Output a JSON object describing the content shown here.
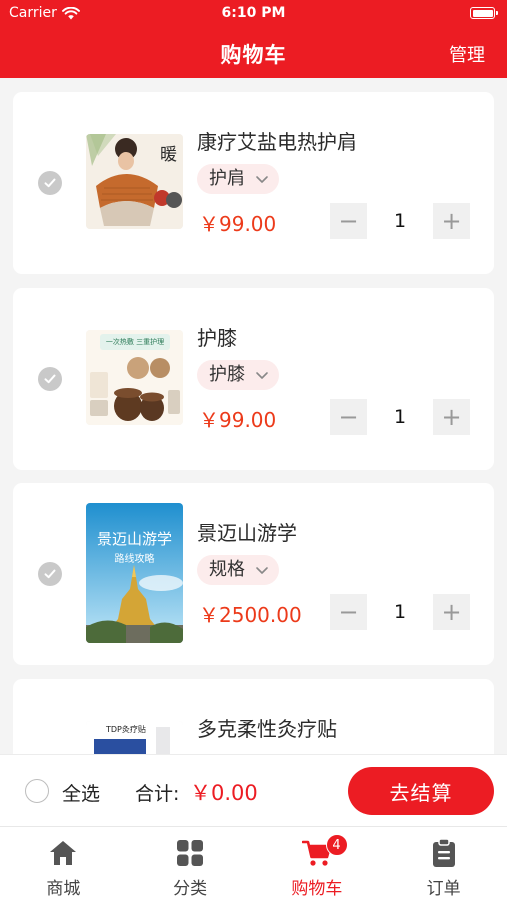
{
  "status_bar": {
    "carrier": "Carrier",
    "time": "6:10 PM"
  },
  "header": {
    "title": "购物车",
    "manage_label": "管理"
  },
  "cart": {
    "items": [
      {
        "name": "康疗艾盐电热护肩",
        "spec": "护肩",
        "price": "￥99.00",
        "quantity": "1",
        "minus": "−",
        "plus": "+"
      },
      {
        "name": "护膝",
        "spec": "护膝",
        "price": "￥99.00",
        "quantity": "1",
        "minus": "−",
        "plus": "+"
      },
      {
        "name": "景迈山游学",
        "spec": "规格",
        "price": "￥2500.00",
        "quantity": "1",
        "minus": "−",
        "plus": "+"
      },
      {
        "name": "多克柔性灸疗贴",
        "spec": "",
        "price": "",
        "quantity": "",
        "minus": "",
        "plus": ""
      }
    ],
    "image_text": {
      "item1_side": "暖",
      "item2_banner": "一次热敷 三重护理",
      "item3_title": "景迈山游学",
      "item3_subtitle": "路线攻略",
      "item4_label": "TDP灸疗贴"
    }
  },
  "checkout": {
    "select_all_label": "全选",
    "total_label": "合计:",
    "total_value": "￥0.00",
    "checkout_button": "去结算"
  },
  "tabbar": {
    "tabs": [
      {
        "label": "商城",
        "icon": "home-icon"
      },
      {
        "label": "分类",
        "icon": "category-grid-icon"
      },
      {
        "label": "购物车",
        "icon": "cart-icon",
        "badge": "4",
        "active": true
      },
      {
        "label": "订单",
        "icon": "clipboard-icon"
      }
    ]
  },
  "colors": {
    "brand_red": "#ec1c23",
    "price_orange": "#ec3a1a",
    "page_background": "#f4f4f4"
  }
}
